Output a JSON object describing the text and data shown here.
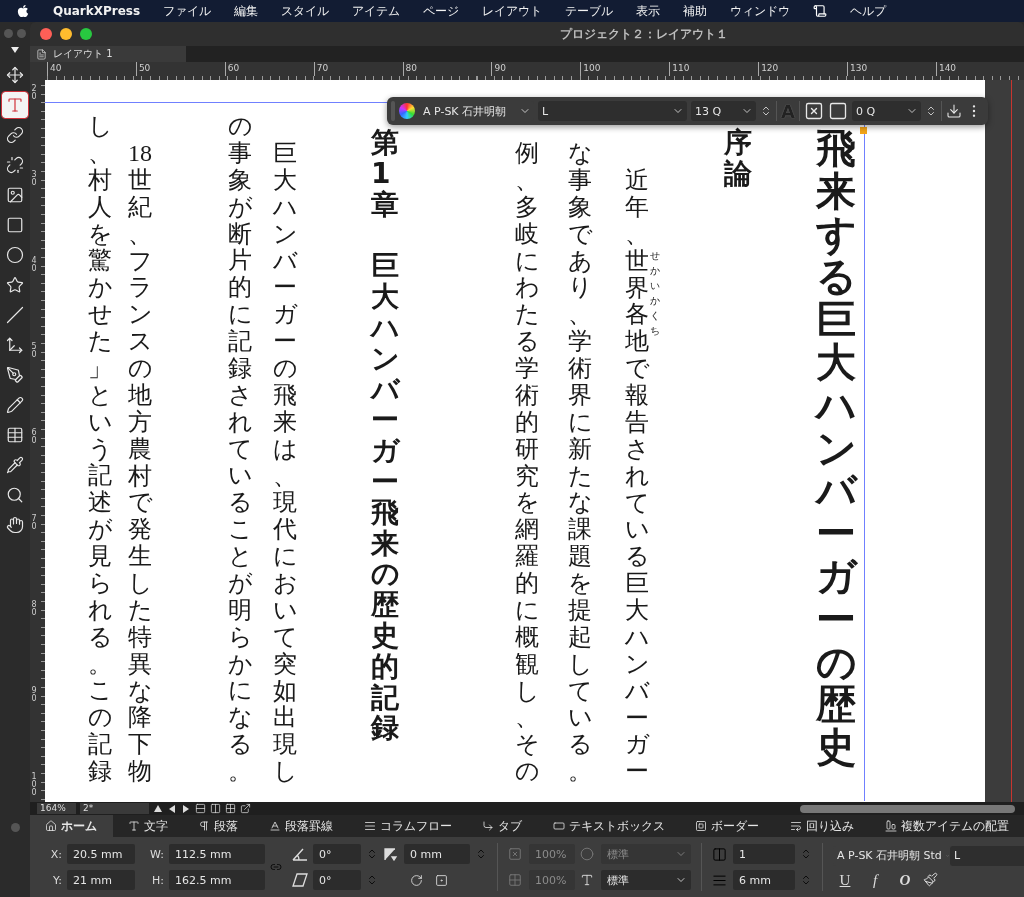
{
  "menu_bar": {
    "app_name": "QuarkXPress",
    "items": [
      {
        "kind": "menu",
        "label": "ファイル"
      },
      {
        "kind": "menu",
        "label": "編集"
      },
      {
        "kind": "menu",
        "label": "スタイル"
      },
      {
        "kind": "menu",
        "label": "アイテム"
      },
      {
        "kind": "menu",
        "label": "ページ"
      },
      {
        "kind": "menu",
        "label": "レイアウト"
      },
      {
        "kind": "menu",
        "label": "テーブル"
      },
      {
        "kind": "menu",
        "label": "表示"
      },
      {
        "kind": "menu",
        "label": "補助"
      },
      {
        "kind": "menu",
        "label": "ウィンドウ"
      },
      {
        "kind": "script"
      },
      {
        "kind": "menu",
        "label": "ヘルプ"
      }
    ]
  },
  "tools": [
    {
      "kind": "move",
      "selected": false
    },
    {
      "kind": "text",
      "selected": true
    },
    {
      "kind": "link",
      "selected": false
    },
    {
      "kind": "unlink",
      "selected": false
    },
    {
      "kind": "picture",
      "selected": false
    },
    {
      "kind": "rectangle",
      "selected": false
    },
    {
      "kind": "oval",
      "selected": false
    },
    {
      "kind": "star",
      "selected": false
    },
    {
      "kind": "line",
      "selected": false
    },
    {
      "kind": "pan",
      "selected": false
    },
    {
      "kind": "pen",
      "selected": false
    },
    {
      "kind": "pencil",
      "selected": false
    },
    {
      "kind": "table",
      "selected": false
    },
    {
      "kind": "eyedropper",
      "selected": false
    },
    {
      "kind": "zoom",
      "selected": false
    },
    {
      "kind": "hand",
      "selected": false
    }
  ],
  "window": {
    "title": "プロジェクト２：レイアウト１"
  },
  "layout_tab": {
    "label": "レイアウト 1"
  },
  "ruler": {
    "horizontal": [
      "40",
      "50",
      "60",
      "70",
      "80",
      "90",
      "100",
      "110",
      "120",
      "130",
      "140"
    ],
    "vertical": [
      "20",
      "30",
      "40",
      "50",
      "60",
      "70",
      "80",
      "90",
      "100"
    ]
  },
  "floating_toolbar": {
    "font": "A P-SK 石井明朝",
    "style": "L",
    "size": "13 Q",
    "text_color_glyph": "A",
    "stroke": "0 Q"
  },
  "page": {
    "columns": [
      {
        "kind": "body",
        "segments": [
          {
            "text": "し、村人を驚かせた」という記述が見られる。この記録"
          }
        ]
      },
      {
        "kind": "paragraph",
        "segments": [
          {
            "text": "18世紀、フランスの地方農村で発生した特異な降下物"
          }
        ]
      },
      {
        "kind": "body",
        "segments": [
          {
            "text": "の事象が断片的に記録されていることが明らかになる。"
          }
        ]
      },
      {
        "kind": "paragraph",
        "segments": [
          {
            "text": "巨大ハンバーガーの飛来は、現代において突如出現し"
          }
        ]
      },
      {
        "kind": "heading",
        "number": "第1章",
        "text": "巨大ハンバーガー飛来の歴史的記録"
      },
      {
        "kind": "body",
        "segments": [
          {
            "text": "例、多岐にわたる学術的研究を網羅的に概観し、その"
          }
        ]
      },
      {
        "kind": "body",
        "segments": [
          {
            "text": "な事象であり、学術界に新たな課題を提起している。"
          }
        ]
      },
      {
        "kind": "paragraph",
        "segments": [
          {
            "text": "近年、"
          },
          {
            "text": "世界各地",
            "ruby": "せかいかくち"
          },
          {
            "text": "で報告されている巨大ハンバーガー"
          }
        ]
      }
    ],
    "section_heading": "序論",
    "title": "飛来する巨大ハンバーガーの歴史"
  },
  "status_bar": {
    "zoom": "164%",
    "page": "2*"
  },
  "measurements": {
    "tabs": [
      {
        "kind": "home",
        "label": "ホーム",
        "selected": true
      },
      {
        "kind": "character",
        "label": "文字",
        "selected": false
      },
      {
        "kind": "paragraph",
        "label": "段落",
        "selected": false
      },
      {
        "kind": "rules",
        "label": "段落罫線",
        "selected": false
      },
      {
        "kind": "column_flow",
        "label": "コラムフロー",
        "selected": false
      },
      {
        "kind": "tabs",
        "label": "タブ",
        "selected": false
      },
      {
        "kind": "text_box",
        "label": "テキストボックス",
        "selected": false
      },
      {
        "kind": "border",
        "label": "ボーダー",
        "selected": false
      },
      {
        "kind": "runaround",
        "label": "回り込み",
        "selected": false
      },
      {
        "kind": "space_align",
        "label": "複数アイテムの配置",
        "selected": false
      }
    ],
    "x_label": "X:",
    "x": "20.5 mm",
    "y_label": "Y:",
    "y": "21 mm",
    "w_label": "W:",
    "w": "112.5 mm",
    "h_label": "H:",
    "h": "162.5 mm",
    "angle": "0°",
    "skew": "0°",
    "corner": "0 mm",
    "opacity_fill": {
      "value": "100%",
      "disabled": true
    },
    "opacity_frame": {
      "value": "100%",
      "disabled": true
    },
    "blend_fill": {
      "value": "標準",
      "disabled": true
    },
    "blend_text": {
      "value": "標準",
      "disabled": false
    },
    "columns": "1",
    "gutter": "6 mm",
    "font": "A P-SK 石井明朝 Std",
    "style": "L",
    "type_styles": [
      "U",
      "f",
      "O"
    ]
  }
}
